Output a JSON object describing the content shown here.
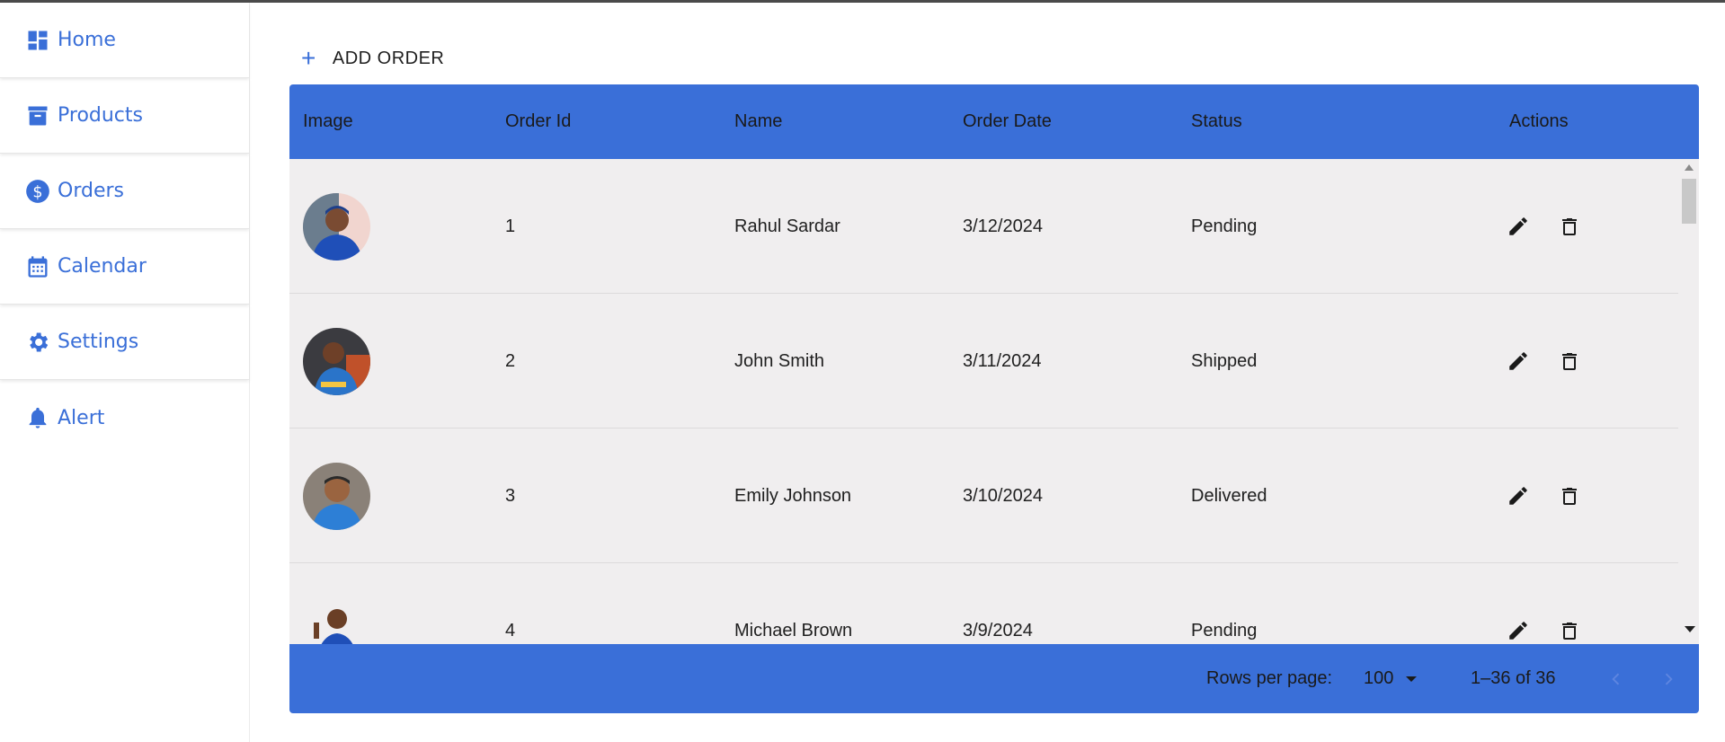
{
  "sidebar": {
    "items": [
      {
        "label": "Home",
        "icon": "dashboard-icon"
      },
      {
        "label": "Products",
        "icon": "archive-box-icon"
      },
      {
        "label": "Orders",
        "icon": "dollar-circle-icon"
      },
      {
        "label": "Calendar",
        "icon": "calendar-icon"
      },
      {
        "label": "Settings",
        "icon": "gear-icon"
      },
      {
        "label": "Alert",
        "icon": "bell-icon"
      }
    ]
  },
  "toolbar": {
    "add_order_label": "ADD ORDER"
  },
  "table": {
    "columns": {
      "image": "Image",
      "order_id": "Order Id",
      "name": "Name",
      "order_date": "Order Date",
      "status": "Status",
      "actions": "Actions"
    },
    "rows": [
      {
        "order_id": "1",
        "name": "Rahul Sardar",
        "order_date": "3/12/2024",
        "status": "Pending"
      },
      {
        "order_id": "2",
        "name": "John Smith",
        "order_date": "3/11/2024",
        "status": "Shipped"
      },
      {
        "order_id": "3",
        "name": "Emily Johnson",
        "order_date": "3/10/2024",
        "status": "Delivered"
      },
      {
        "order_id": "4",
        "name": "Michael Brown",
        "order_date": "3/9/2024",
        "status": "Pending"
      }
    ]
  },
  "pagination": {
    "rows_per_page_label": "Rows per page:",
    "rows_per_page_value": "100",
    "range_text": "1–36 of 36"
  },
  "colors": {
    "accent": "#3a6fd8",
    "row_background": "#f0eeef"
  }
}
